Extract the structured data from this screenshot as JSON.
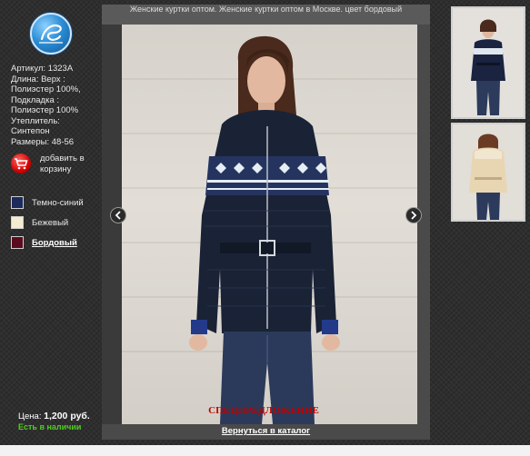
{
  "viewer": {
    "title": "Женские куртки оптом. Женские куртки оптом в Москве. цвет бордовый",
    "promo": "СПЕЦПРЕДЛОЖЕНИЕ",
    "back_link": "Вернуться в каталог"
  },
  "product": {
    "article": "Артикул: 1323А",
    "length": "Длина: Верх :",
    "outer": "Полиэстер 100%,",
    "lining_label": "Подкладка :",
    "lining": "Полиэстер 100%",
    "insulation_label": "Утеплитель:",
    "insulation": "Синтепон",
    "sizes": "Размеры: 48-56"
  },
  "cart": {
    "label": "добавить в корзину"
  },
  "colors": [
    {
      "label": "Темно-синий",
      "hex": "#1c2a5c",
      "selected": false
    },
    {
      "label": "Бежевый",
      "hex": "#f3ecd0",
      "selected": false
    },
    {
      "label": "Бордовый",
      "hex": "#5a0b1e",
      "selected": true
    }
  ],
  "price": {
    "label": "Цена:",
    "value": "1,200 руб."
  },
  "stock": "Есть в наличии",
  "icons": {
    "logo": "logo-icon",
    "cart": "cart-icon",
    "prev": "chevron-left-icon",
    "next": "chevron-right-icon"
  },
  "accent_colors": {
    "stock": "#4ed11d",
    "promo": "#c00000",
    "cart": "#d40000"
  }
}
